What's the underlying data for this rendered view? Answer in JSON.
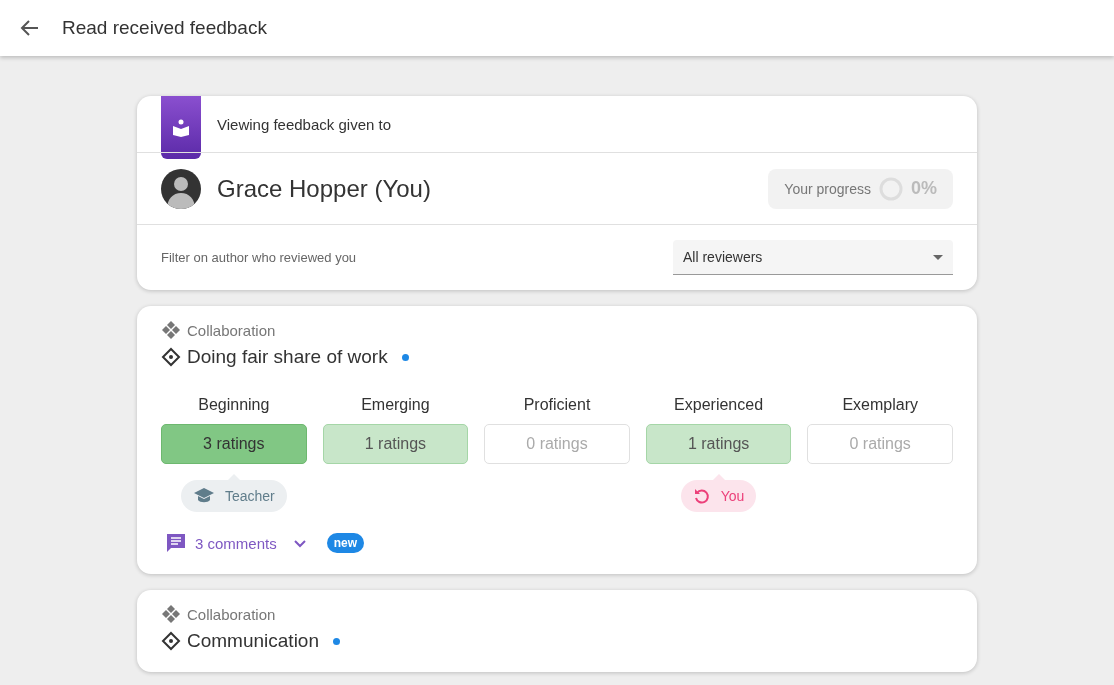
{
  "app_bar": {
    "title": "Read received feedback"
  },
  "summary": {
    "caption": "Viewing feedback given to",
    "name": "Grace Hopper (You)",
    "progress": {
      "label": "Your progress",
      "value": "0%"
    },
    "filter": {
      "label": "Filter on author who reviewed you",
      "value": "All reviewers"
    }
  },
  "criteria": [
    {
      "category": "Collaboration",
      "title": "Doing fair share of work",
      "unread": true,
      "levels": [
        {
          "name": "Beginning",
          "ratings": "3 ratings",
          "kind": "strong",
          "badge": {
            "kind": "teacher",
            "label": "Teacher"
          }
        },
        {
          "name": "Emerging",
          "ratings": "1 ratings",
          "kind": "light"
        },
        {
          "name": "Proficient",
          "ratings": "0 ratings",
          "kind": "empty"
        },
        {
          "name": "Experienced",
          "ratings": "1 ratings",
          "kind": "light",
          "badge": {
            "kind": "self",
            "label": "You"
          }
        },
        {
          "name": "Exemplary",
          "ratings": "0 ratings",
          "kind": "empty"
        }
      ],
      "comments": {
        "label": "3 comments",
        "expanded": false,
        "badge": "new"
      }
    },
    {
      "category": "Collaboration",
      "title": "Communication",
      "unread": true
    }
  ]
}
